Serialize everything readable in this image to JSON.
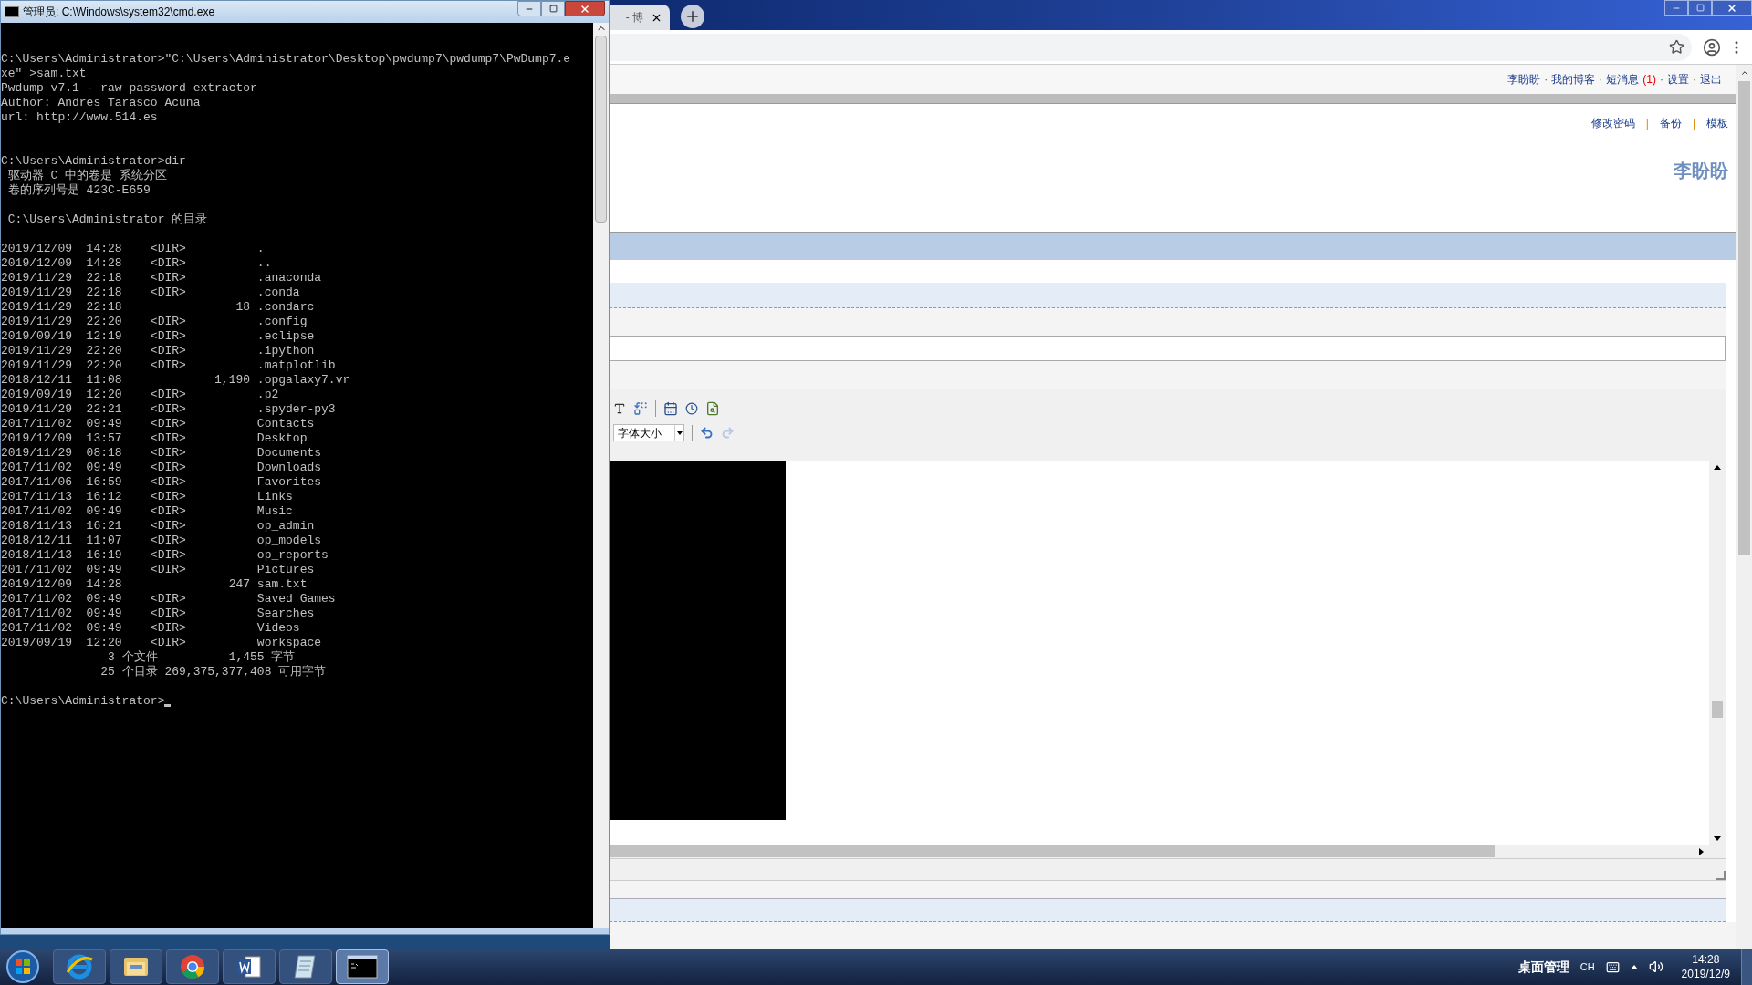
{
  "cmd_window": {
    "title": "管理员: C:\\Windows\\system32\\cmd.exe",
    "blocks": [
      {
        "lines": [
          "C:\\Users\\Administrator>\"C:\\Users\\Administrator\\Desktop\\pwdump7\\pwdump7\\PwDump7.e",
          "xe\" >sam.txt",
          "Pwdump v7.1 - raw password extractor",
          "Author: Andres Tarasco Acuna",
          "url: http://www.514.es"
        ]
      },
      {
        "lines": [
          "C:\\Users\\Administrator>dir",
          " 驱动器 C 中的卷是 系统分区",
          " 卷的序列号是 423C-E659"
        ]
      },
      {
        "lines": [
          " C:\\Users\\Administrator 的目录"
        ]
      },
      {
        "lines": [
          "2019/12/09  14:28    <DIR>          .",
          "2019/12/09  14:28    <DIR>          ..",
          "2019/11/29  22:18    <DIR>          .anaconda",
          "2019/11/29  22:18    <DIR>          .conda",
          "2019/11/29  22:18                18 .condarc",
          "2019/11/29  22:20    <DIR>          .config",
          "2019/09/19  12:19    <DIR>          .eclipse",
          "2019/11/29  22:20    <DIR>          .ipython",
          "2019/11/29  22:20    <DIR>          .matplotlib",
          "2018/12/11  11:08             1,190 .opgalaxy7.vr",
          "2019/09/19  12:20    <DIR>          .p2",
          "2019/11/29  22:21    <DIR>          .spyder-py3",
          "2017/11/02  09:49    <DIR>          Contacts",
          "2019/12/09  13:57    <DIR>          Desktop",
          "2019/11/29  08:18    <DIR>          Documents",
          "2017/11/02  09:49    <DIR>          Downloads",
          "2017/11/06  16:59    <DIR>          Favorites",
          "2017/11/13  16:12    <DIR>          Links",
          "2017/11/02  09:49    <DIR>          Music",
          "2018/11/13  16:21    <DIR>          op_admin",
          "2018/12/11  11:07    <DIR>          op_models",
          "2018/11/13  16:19    <DIR>          op_reports",
          "2017/11/02  09:49    <DIR>          Pictures",
          "2019/12/09  14:28               247 sam.txt",
          "2017/11/02  09:49    <DIR>          Saved Games",
          "2017/11/02  09:49    <DIR>          Searches",
          "2017/11/02  09:49    <DIR>          Videos",
          "2019/09/19  12:20    <DIR>          workspace",
          "               3 个文件          1,455 字节",
          "              25 个目录 269,375,377,408 可用字节"
        ]
      },
      {
        "cursor": true,
        "lines": [
          "C:\\Users\\Administrator>"
        ]
      }
    ]
  },
  "browser": {
    "tab": {
      "title": "- 博"
    },
    "user_nav": {
      "separator": "·",
      "items": [
        {
          "text": "李盼盼"
        },
        {
          "text": "我的博客"
        },
        {
          "text": "短消息",
          "badge": "(1)"
        },
        {
          "text": "设置"
        },
        {
          "text": "退出"
        }
      ]
    },
    "blog_links": {
      "separator": "|",
      "items": [
        "修改密码",
        "备份",
        "模板"
      ]
    },
    "blog_title": "李盼盼",
    "editor": {
      "font_size_select": "字体大小",
      "undo": {
        "disabled": false
      },
      "redo": {
        "disabled": true
      }
    }
  },
  "taskbar": {
    "apps": [
      {
        "kind": "ie",
        "selected": false
      },
      {
        "kind": "folder",
        "selected": false
      },
      {
        "kind": "chrome",
        "selected": false
      },
      {
        "kind": "word",
        "selected": false
      },
      {
        "kind": "notepad",
        "selected": false
      },
      {
        "kind": "cmd",
        "selected": true
      }
    ],
    "tray_label": "桌面管理",
    "language": "CH",
    "time": "14:28",
    "date": "2019/12/9"
  }
}
